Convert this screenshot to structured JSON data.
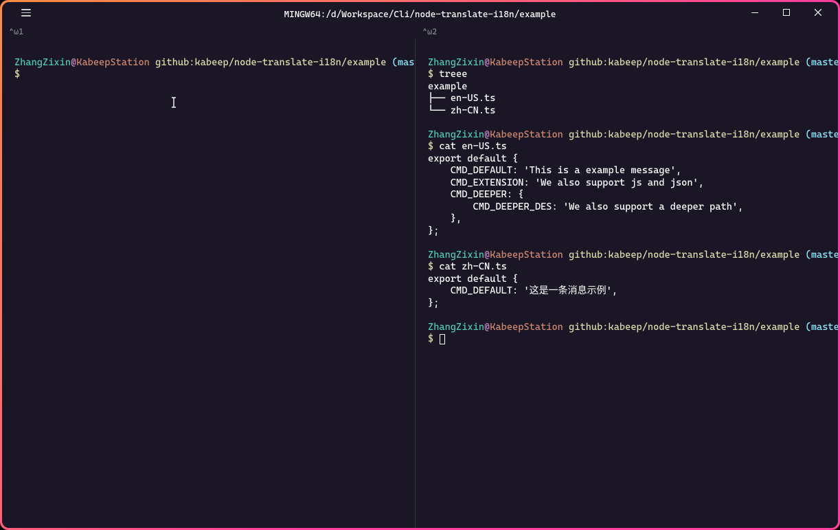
{
  "window": {
    "title": "MINGW64:/d/Workspace/Cli/node-translate-i18n/example"
  },
  "panes": {
    "left_label": "^⍵1",
    "right_label": "^⍵2"
  },
  "prompt": {
    "user": "ZhangZixin",
    "at": "@",
    "host": "KabeepStation",
    "path": "github:kabeep/node-translate-i18n/example",
    "branch": "(master)",
    "dollar": "$"
  },
  "left_pane": {},
  "right_pane": {
    "cmd1": "treee",
    "tree_root": "example",
    "tree_line1": "├── en-US.ts",
    "tree_line2": "└── zh-CN.ts",
    "cmd2": "cat en-US.ts",
    "file1_line1": "export default {",
    "file1_line2": "    CMD_DEFAULT: 'This is a example message',",
    "file1_line3": "    CMD_EXTENSION: 'We also support js and json',",
    "file1_line4": "    CMD_DEEPER: {",
    "file1_line5": "        CMD_DEEPER_DES: 'We also support a deeper path',",
    "file1_line6": "    },",
    "file1_line7": "};",
    "cmd3": "cat zh-CN.ts",
    "file2_line1": "export default {",
    "file2_line2": "    CMD_DEFAULT: '这是一条消息示例',",
    "file2_line3": "};"
  }
}
